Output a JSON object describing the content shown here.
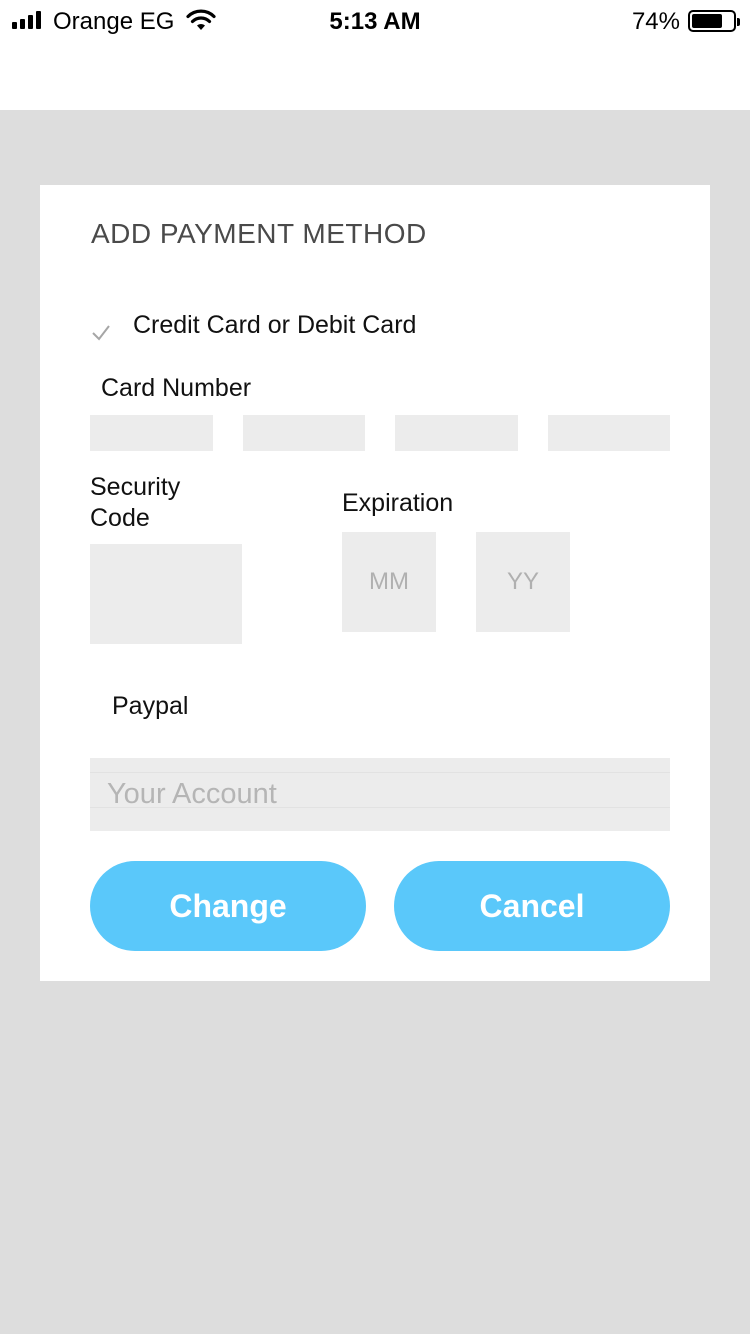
{
  "status_bar": {
    "carrier": "Orange EG",
    "time": "5:13 AM",
    "battery_percent": "74%",
    "battery_level": 0.74
  },
  "dialog": {
    "title": "ADD PAYMENT METHOD",
    "credit_option": {
      "label": "Credit Card or Debit Card",
      "icon": "checkmark-icon",
      "checked": true
    },
    "card_number_label": "Card Number",
    "security_code_label": "Security Code",
    "expiration_label": "Expiration",
    "month_placeholder": "MM",
    "year_placeholder": "YY",
    "paypal_label": "Paypal",
    "account_placeholder": "Your Account",
    "change_label": "Change",
    "cancel_label": "Cancel"
  },
  "colors": {
    "accent": "#5ac8fa",
    "backdrop": "#dddddd",
    "field": "#ececec"
  }
}
